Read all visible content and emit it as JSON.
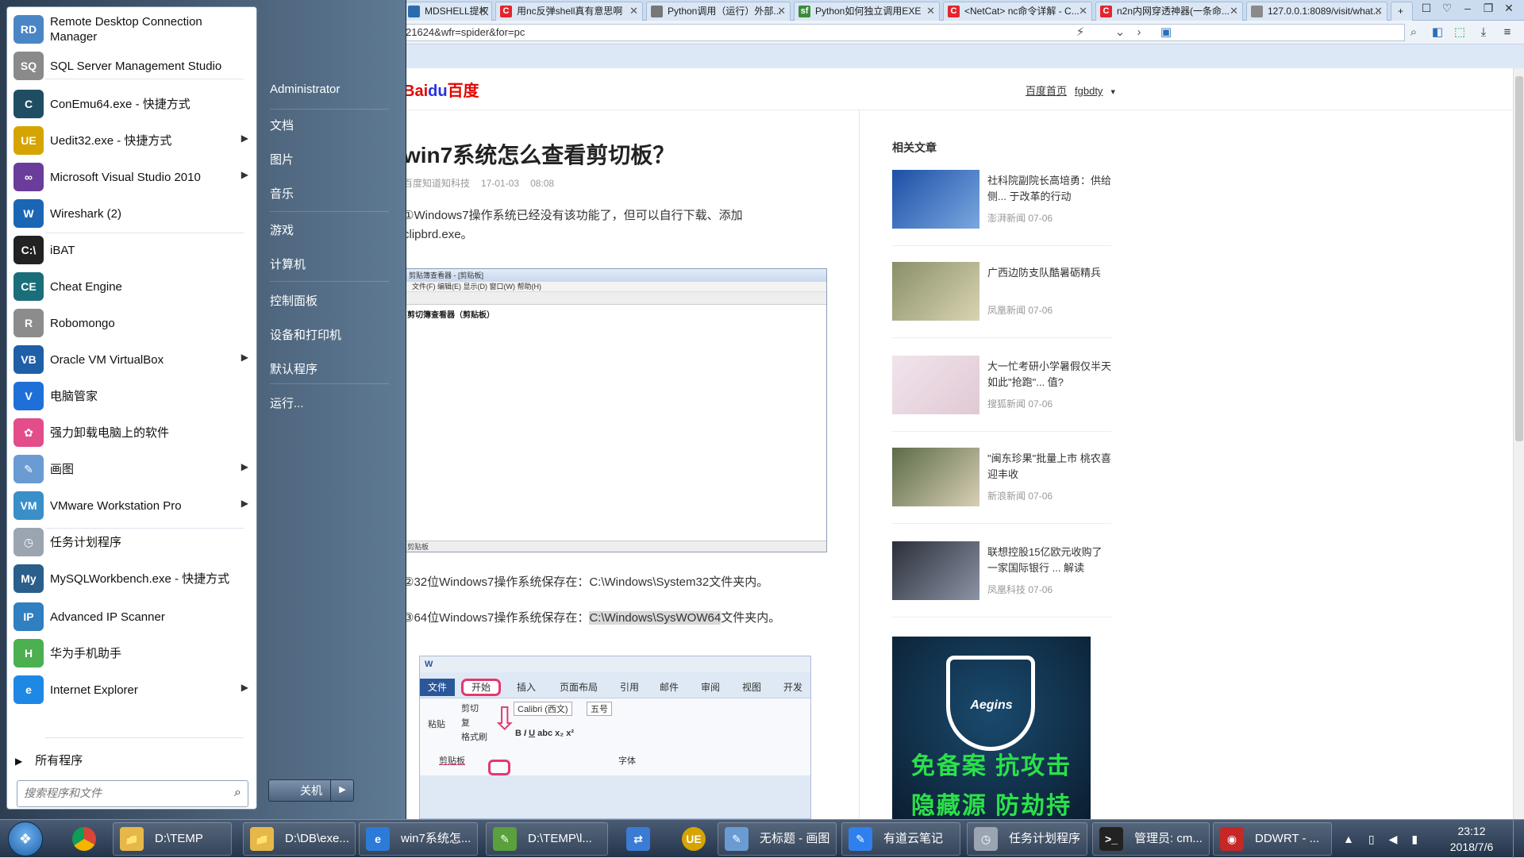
{
  "browser": {
    "tabs": [
      {
        "title": "MDSHELL提权",
        "icon_color": "#2b6cb0"
      },
      {
        "title": "用nc反弹shell真有意思啊",
        "icon_color": "#e3262e",
        "icon": "C"
      },
      {
        "title": "Python调用（运行）外部...",
        "icon_color": "#777777"
      },
      {
        "title": "Python如何独立调用EXE",
        "icon_color": "#3b8c3b",
        "icon": "sf"
      },
      {
        "title": "<NetCat> nc命令详解 - C...",
        "icon_color": "#e3262e",
        "icon": "C"
      },
      {
        "title": "n2n内网穿透神器(一条命...",
        "icon_color": "#e3262e",
        "icon": "C"
      },
      {
        "title": "127.0.0.1:8089/visit/what...",
        "icon_color": "#8a8a8a"
      }
    ],
    "new_tab": "+",
    "url": "21624&wfr=spider&for=pc",
    "window_buttons": [
      "☐",
      "♡",
      "–",
      "❐",
      "✕"
    ]
  },
  "page": {
    "logo": {
      "part1": "Bai",
      "part2": "du",
      "part3": "百度"
    },
    "toplinks": {
      "home": "百度首页",
      "user": "fgbdty"
    },
    "article": {
      "title": "win7系统怎么查看剪切板？",
      "source": "百度知道知科技",
      "date": "17-01-03",
      "time": "08:08",
      "p1_line1": "①Windows7操作系统已经没有该功能了，但可以自行下载、添加",
      "p1_line2": "clipbrd.exe。",
      "p2": "②32位Windows7操作系统保存在：C:\\Windows\\System32文件夹内。",
      "p3_prefix": "③64位Windows7操作系统保存在：",
      "p3_highlight": "C:\\Windows\\SysWOW64",
      "p3_suffix": "文件夹内。"
    },
    "screenshot1": {
      "title": "剪贴簿查看器 - [剪贴板]",
      "menu": "文件(F)  编辑(E)  显示(D)  窗口(W)  帮助(H)",
      "body": "剪切簿查看器（剪贴板）",
      "status": "剪贴板"
    },
    "screenshot2": {
      "tabs": [
        "文件",
        "开始",
        "插入",
        "页面布局",
        "引用",
        "邮件",
        "审阅",
        "视图",
        "开发工"
      ],
      "paste": "粘贴",
      "cut": "剪切",
      "copy": "复",
      "format_painter": "格式刷",
      "font_name": "Calibri (西文)",
      "font_size": "五号",
      "clipboard_group": "剪贴板",
      "font_group": "字体"
    },
    "related": {
      "heading": "相关文章",
      "items": [
        {
          "text": "社科院副院长高培勇：供给侧... 于改革的行动",
          "source": "澎湃新闻",
          "date": "07-06"
        },
        {
          "text": "广西边防支队酷暑砺精兵",
          "source": "凤凰新闻",
          "date": "07-06"
        },
        {
          "text": "大一忙考研小学暑假仅半天 如此\"抢跑\"... 值?",
          "source": "搜狐新闻",
          "date": "07-06"
        },
        {
          "text": "\"闽东珍果\"批量上市 桃农喜迎丰收",
          "source": "新浪新闻",
          "date": "07-06"
        },
        {
          "text": "联想控股15亿欧元收购了一家国际银行 ... 解读",
          "source": "凤凰科技",
          "date": "07-06"
        }
      ]
    },
    "ad": {
      "brand": "Aegins",
      "line1": "免备案 抗攻击",
      "line2": "隐藏源 防劫持"
    }
  },
  "startmenu": {
    "apps": [
      {
        "label": "Remote Desktop Connection Manager",
        "icon_color": "#4a86c5",
        "icon": "RD",
        "arrow": false
      },
      {
        "label": "SQL Server Management Studio",
        "icon_color": "#8a8a8a",
        "icon": "SQ",
        "arrow": false
      },
      {
        "label": "ConEmu64.exe - 快捷方式",
        "icon_color": "#1f4e63",
        "icon": "C",
        "arrow": false
      },
      {
        "label": "Uedit32.exe - 快捷方式",
        "icon_color": "#d6a400",
        "icon": "UE",
        "arrow": true
      },
      {
        "label": "Microsoft Visual Studio 2010",
        "icon_color": "#6a3d9a",
        "icon": "∞",
        "arrow": true
      },
      {
        "label": "Wireshark (2)",
        "icon_color": "#1a66b5",
        "icon": "W",
        "arrow": false
      },
      {
        "label": "iBAT",
        "icon_color": "#222222",
        "icon": "C:\\",
        "arrow": false
      },
      {
        "label": "Cheat Engine",
        "icon_color": "#1a6e7a",
        "icon": "CE",
        "arrow": false
      },
      {
        "label": "Robomongo",
        "icon_color": "#8c8c8c",
        "icon": "R",
        "arrow": false
      },
      {
        "label": "Oracle VM VirtualBox",
        "icon_color": "#1f5fa8",
        "icon": "VB",
        "arrow": true
      },
      {
        "label": "电脑管家",
        "icon_color": "#1e6fd8",
        "icon": "V",
        "arrow": false
      },
      {
        "label": "强力卸载电脑上的软件",
        "icon_color": "#e24d8a",
        "icon": "✿",
        "arrow": false
      },
      {
        "label": "画图",
        "icon_color": "#6a9bd2",
        "icon": "✎",
        "arrow": true
      },
      {
        "label": "VMware Workstation Pro",
        "icon_color": "#3a8fc9",
        "icon": "VM",
        "arrow": true
      },
      {
        "label": "任务计划程序",
        "icon_color": "#9aa5b1",
        "icon": "◷",
        "arrow": false
      },
      {
        "label": "MySQLWorkbench.exe - 快捷方式",
        "icon_color": "#2a5f8c",
        "icon": "My",
        "arrow": false
      },
      {
        "label": "Advanced IP Scanner",
        "icon_color": "#2f7fc1",
        "icon": "IP",
        "arrow": false
      },
      {
        "label": "华为手机助手",
        "icon_color": "#4caf50",
        "icon": "H",
        "arrow": false
      },
      {
        "label": "Internet Explorer",
        "icon_color": "#1e88e5",
        "icon": "e",
        "arrow": true
      }
    ],
    "all_programs": "所有程序",
    "search_placeholder": "搜索程序和文件",
    "right_items": [
      "Administrator",
      "文档",
      "图片",
      "音乐",
      "游戏",
      "计算机",
      "控制面板",
      "设备和打印机",
      "默认程序",
      "运行..."
    ],
    "shutdown": "关机"
  },
  "taskbar": {
    "items": [
      {
        "label": "D:\\TEMP",
        "icon_color": "#e6b84a",
        "icon": "📁"
      },
      {
        "label": "D:\\DB\\exe...",
        "icon_color": "#e6b84a",
        "icon": "📁"
      },
      {
        "label": "win7系统怎...",
        "icon_color": "#2c7bd8",
        "icon": "e"
      },
      {
        "label": "D:\\TEMP\\l...",
        "icon_color": "#5aa03c",
        "icon": "✎"
      },
      {
        "label": "无标题 - 画图",
        "icon_color": "#6a9bd2",
        "icon": "✎"
      },
      {
        "label": "有道云笔记",
        "icon_color": "#2f80ed",
        "icon": "✎"
      },
      {
        "label": "任务计划程序",
        "icon_color": "#9aa5b1",
        "icon": "◷"
      },
      {
        "label": "管理员: cm...",
        "icon_color": "#222222",
        "icon": ">_"
      },
      {
        "label": "DDWRT - ...",
        "icon_color": "#c62828",
        "icon": "◉"
      }
    ],
    "clock_time": "23:12",
    "clock_date": "2018/7/6"
  }
}
